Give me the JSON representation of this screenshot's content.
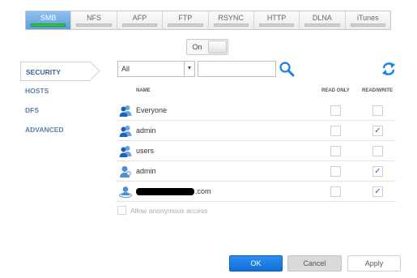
{
  "tabs": [
    {
      "label": "SMB",
      "active": true
    },
    {
      "label": "NFS",
      "active": false
    },
    {
      "label": "AFP",
      "active": false
    },
    {
      "label": "FTP",
      "active": false
    },
    {
      "label": "RSYNC",
      "active": false
    },
    {
      "label": "HTTP",
      "active": false
    },
    {
      "label": "DLNA",
      "active": false
    },
    {
      "label": "iTunes",
      "active": false
    }
  ],
  "toggle": {
    "label": "On"
  },
  "sidebar": {
    "items": [
      {
        "label": "SECURITY",
        "active": true
      },
      {
        "label": "HOSTS",
        "active": false
      },
      {
        "label": "DFS",
        "active": false
      },
      {
        "label": "ADVANCED",
        "active": false
      }
    ]
  },
  "filter": {
    "selected": "All",
    "search_value": ""
  },
  "table": {
    "headers": {
      "name": "NAME",
      "read_only": "READ ONLY",
      "read_write": "READ/WRITE"
    },
    "rows": [
      {
        "name": "Everyone",
        "icon": "group-icon",
        "read_only": false,
        "read_write": false
      },
      {
        "name": "admin",
        "icon": "group-icon",
        "read_only": false,
        "read_write": true
      },
      {
        "name": "users",
        "icon": "group-icon",
        "read_only": false,
        "read_write": false
      },
      {
        "name": "admin",
        "icon": "user-icon",
        "read_only": false,
        "read_write": true
      },
      {
        "name": ".com",
        "icon": "domain-user-icon",
        "masked": true,
        "read_only": false,
        "read_write": true
      }
    ]
  },
  "anonymous": {
    "label": "Allow anonymous access",
    "checked": false
  },
  "buttons": {
    "ok": "OK",
    "cancel": "Cancel",
    "apply": "Apply"
  },
  "colors": {
    "accent": "#1a7fe8",
    "active_tab": "#6aaae6",
    "indicator": "#2fcc2f",
    "sidebar_text": "#5f7f9f"
  },
  "check_glyph": "✓"
}
